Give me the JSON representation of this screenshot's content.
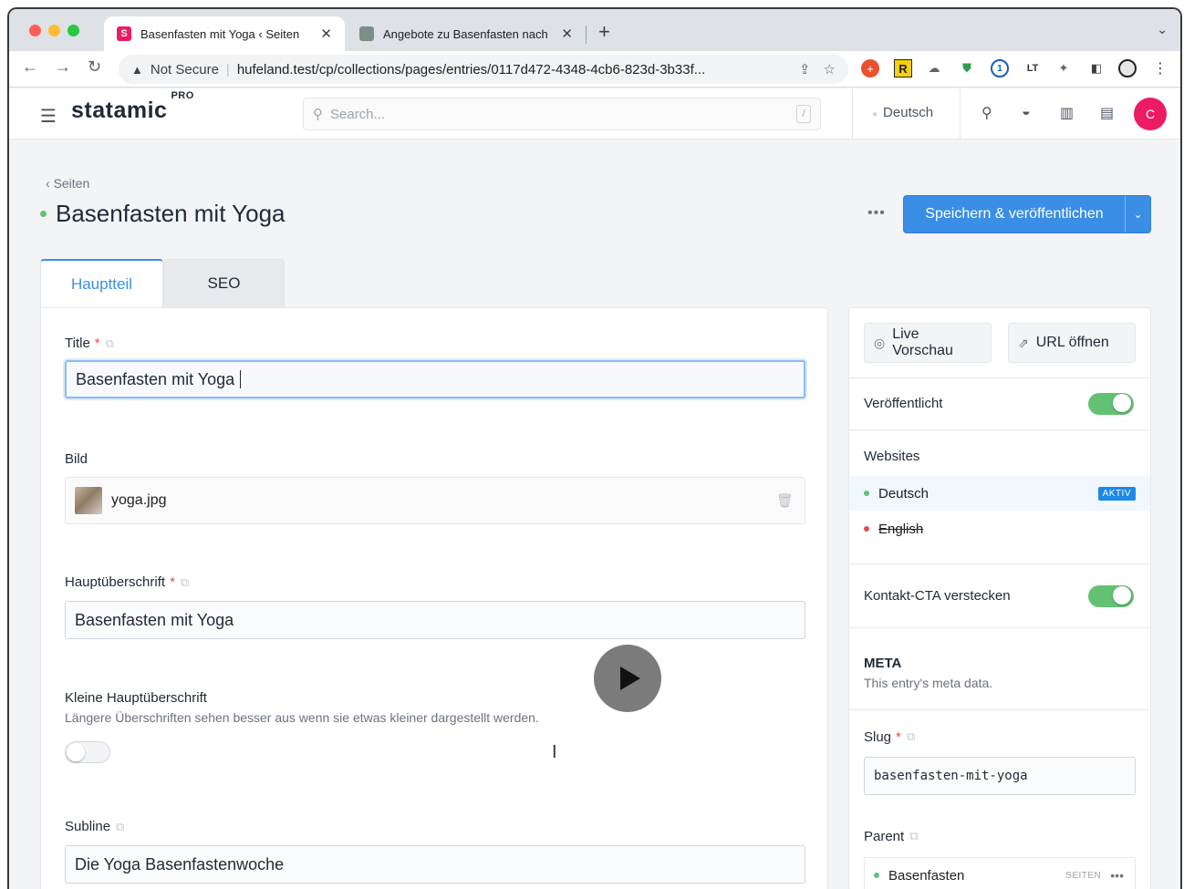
{
  "browser": {
    "tabs": [
      {
        "favicon": "S",
        "title": "Basenfasten mit Yoga ‹ Seiten",
        "close": "✕"
      },
      {
        "favicon": "",
        "title": "Angebote zu Basenfasten nach",
        "close": "✕"
      }
    ],
    "new_tab": "+",
    "address": {
      "security": "Not Secure",
      "url": "hufeland.test/cp/collections/pages/entries/0117d472-4348-4cb6-823d-3b33f..."
    }
  },
  "header": {
    "logo": "statamic",
    "logo_badge": "PRO",
    "search_placeholder": "Search...",
    "search_shortcut": "/",
    "site": "Deutsch",
    "avatar": "C"
  },
  "page": {
    "breadcrumb": "Seiten",
    "title": "Basenfasten mit Yoga",
    "more": "•••",
    "save_label": "Speichern & veröffentlichen",
    "tabs": [
      "Hauptteil",
      "SEO"
    ]
  },
  "fields": {
    "title": {
      "label": "Title",
      "required": "*",
      "value": "Basenfasten mit Yoga"
    },
    "bild": {
      "label": "Bild",
      "file": "yoga.jpg"
    },
    "hauptueberschrift": {
      "label": "Hauptüberschrift",
      "required": "*",
      "value": "Basenfasten mit Yoga"
    },
    "kleine": {
      "label": "Kleine Hauptüberschrift",
      "help": "Längere Überschriften sehen besser aus wenn sie etwas kleiner dargestellt werden.",
      "toggle_on": false
    },
    "subline": {
      "label": "Subline",
      "value": "Die Yoga Basenfastenwoche"
    }
  },
  "sidebar": {
    "live_preview": "Live Vorschau",
    "open_url": "URL öffnen",
    "published": {
      "label": "Veröffentlicht",
      "on": true
    },
    "websites": {
      "label": "Websites",
      "items": [
        {
          "name": "Deutsch",
          "badge": "AKTIV",
          "color": "#63c174"
        },
        {
          "name": "English",
          "badge": "",
          "color": "#e24d4d"
        }
      ]
    },
    "hide_cta": {
      "label": "Kontakt-CTA verstecken",
      "on": true
    },
    "meta": {
      "title": "META",
      "subtitle": "This entry's meta data."
    },
    "slug": {
      "label": "Slug",
      "required": "*",
      "value": "basenfasten-mit-yoga"
    },
    "parent": {
      "label": "Parent",
      "value": "Basenfasten",
      "collection": "SEITEN",
      "more": "•••"
    }
  },
  "colors": {
    "accent": "#3a8ee6",
    "toggle_on": "#63c174",
    "avatar": "#ec1b64"
  }
}
